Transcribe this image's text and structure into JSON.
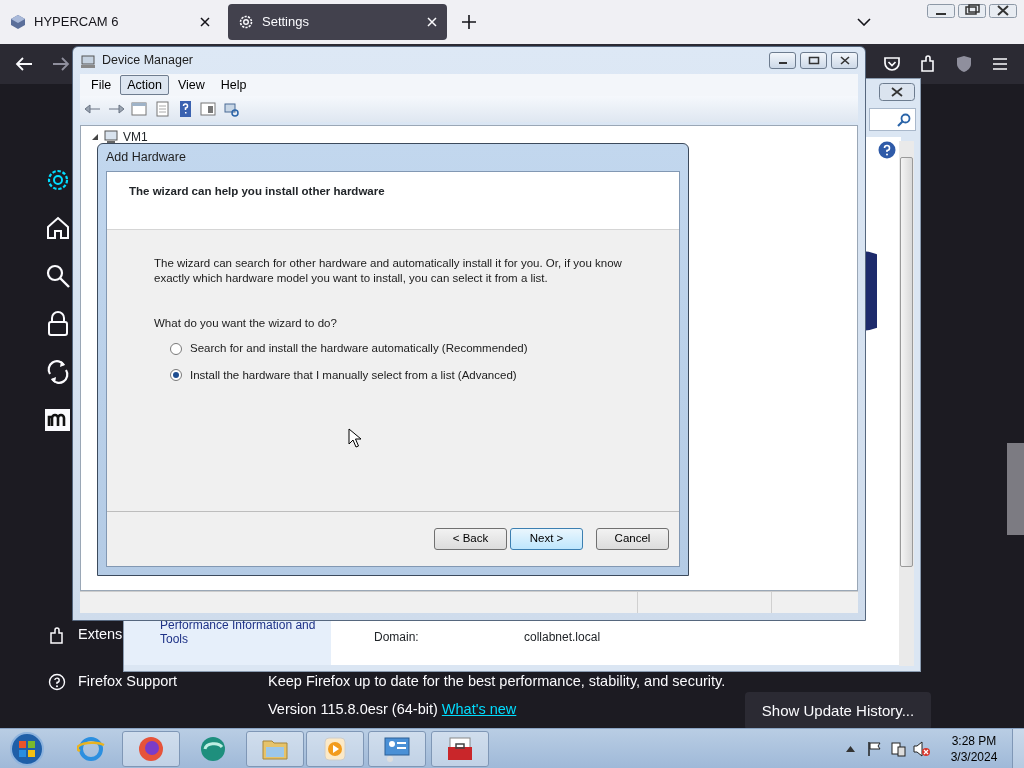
{
  "browser": {
    "tabs": [
      {
        "label": "HYPERCAM 6",
        "selected": false
      },
      {
        "label": "Settings",
        "selected": true
      }
    ],
    "sidebar": [
      {
        "kind": "gear",
        "selected": true
      },
      {
        "kind": "home",
        "selected": false
      },
      {
        "kind": "search",
        "selected": false
      },
      {
        "kind": "lock",
        "selected": false
      },
      {
        "kind": "sync",
        "selected": false
      },
      {
        "kind": "m",
        "selected": false
      }
    ],
    "footer_links": [
      "Extens",
      "Firefox Support"
    ],
    "update_text": "Keep Firefox up to date for the best performance, stability, and security.",
    "version": "Version 115.8.0esr (64-bit)",
    "whats_new": "What's new",
    "history_button": "Show Update History..."
  },
  "system_window": {
    "left_link": "Performance Information and Tools",
    "rows": [
      {
        "label": "Domain:",
        "value": "collabnet.local"
      }
    ]
  },
  "device_manager": {
    "title": "Device Manager",
    "menu": [
      {
        "label": "File",
        "selected": false
      },
      {
        "label": "Action",
        "selected": true
      },
      {
        "label": "View",
        "selected": false
      },
      {
        "label": "Help",
        "selected": false
      }
    ],
    "tree": [
      {
        "label": "VM1",
        "expanded": true
      }
    ]
  },
  "add_hardware": {
    "title": "Add Hardware",
    "header": "The wizard can help you install other hardware",
    "intro": "The wizard can search for other hardware and automatically install it for you. Or, if you know exactly which hardware model you want to install, you can select it from a list.",
    "question": "What do you want the wizard to do?",
    "options": [
      {
        "label": "Search for and install the hardware automatically (Recommended)",
        "selected": false
      },
      {
        "label": "Install the hardware that I manually select from a list (Advanced)",
        "selected": true
      }
    ],
    "buttons": [
      {
        "label": "< Back",
        "default": false
      },
      {
        "label": "Next >",
        "default": true
      },
      {
        "label": "Cancel",
        "default": false
      }
    ]
  },
  "taskbar": {
    "time": "3:28 PM",
    "date": "3/3/2024"
  }
}
